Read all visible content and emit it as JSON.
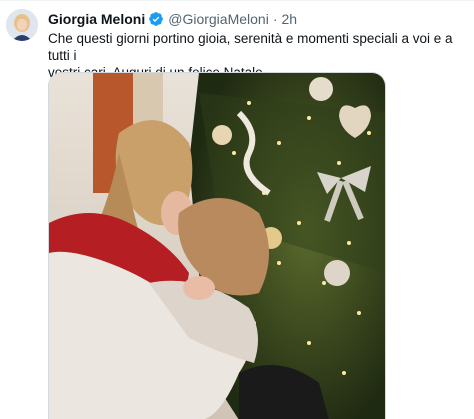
{
  "tweet": {
    "author": {
      "display_name": "Giorgia Meloni",
      "handle": "@GiorgiaMeloni",
      "verified": true,
      "avatar_icon": "profile-photo"
    },
    "separator": "·",
    "time": "2h",
    "text_lines": [
      "Che questi giorni portino gioia, serenità e momenti speciali a voi e a tutti i",
      "vostri cari. Auguri di un felice Natale."
    ],
    "media": {
      "type": "photo",
      "icon": "christmas-tree-hug-photo"
    }
  },
  "colors": {
    "text_primary": "#0f1419",
    "text_secondary": "#536471",
    "verified_badge": "#1d9bf0",
    "border": "#cfd9de"
  }
}
